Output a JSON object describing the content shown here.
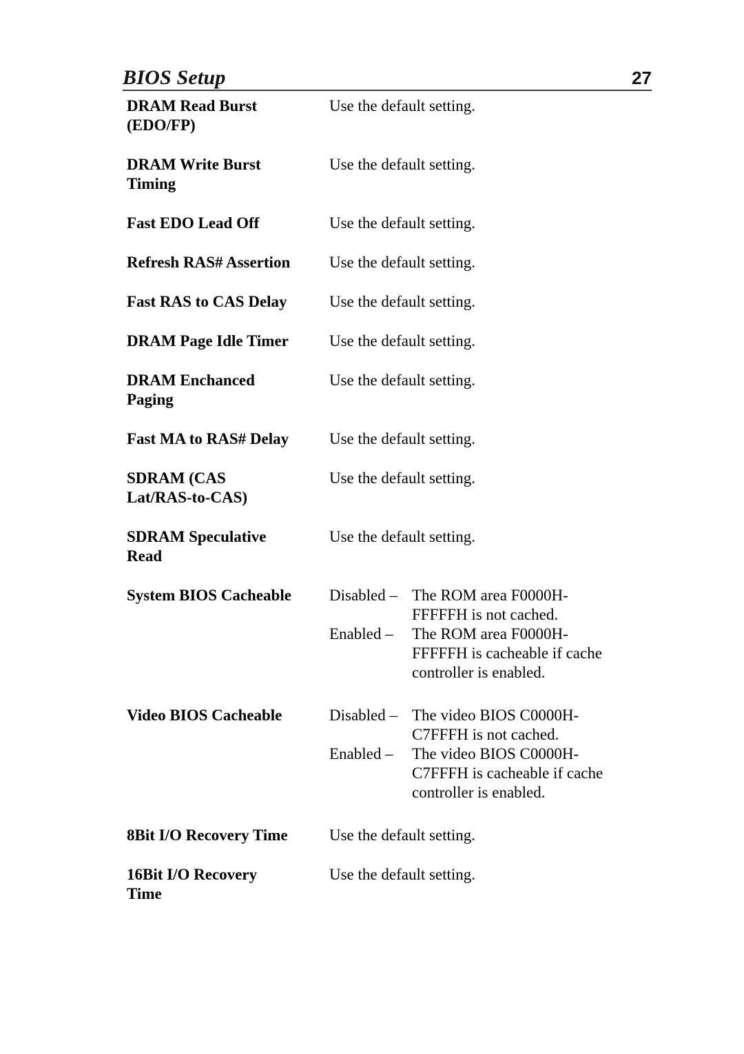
{
  "header": {
    "title": "BIOS Setup",
    "page_number": "27",
    "rule": "#3a3a3a"
  },
  "default_text": "Use the default setting.",
  "rows": [
    {
      "label_lines": [
        "DRAM Read Burst",
        "(EDO/FP)"
      ],
      "desc_lines": [
        "Use the default setting."
      ]
    },
    {
      "label_lines": [
        "DRAM Write Burst",
        "Timing"
      ],
      "desc_lines": [
        "Use the default setting."
      ]
    },
    {
      "label_lines": [
        "Fast EDO Lead Off"
      ],
      "desc_lines": [
        "Use the default setting."
      ]
    },
    {
      "label_lines": [
        "Refresh RAS# Assertion"
      ],
      "desc_lines": [
        "Use the default setting."
      ]
    },
    {
      "label_lines": [
        "Fast RAS to CAS Delay"
      ],
      "desc_lines": [
        "Use the default setting."
      ]
    },
    {
      "label_lines": [
        "DRAM Page Idle Timer"
      ],
      "desc_lines": [
        "Use the default setting."
      ]
    },
    {
      "label_lines": [
        "DRAM Enchanced",
        "Paging"
      ],
      "desc_lines": [
        "Use the default setting."
      ]
    },
    {
      "label_lines": [
        "Fast MA to RAS# Delay"
      ],
      "desc_lines": [
        "Use the default setting."
      ]
    },
    {
      "label_lines": [
        "SDRAM (CAS",
        "Lat/RAS-to-CAS)"
      ],
      "desc_lines": [
        "Use the default setting."
      ]
    },
    {
      "label_lines": [
        "SDRAM Speculative",
        "Read"
      ],
      "desc_lines": [
        "Use the default setting."
      ]
    },
    {
      "label_lines": [
        "System BIOS Cacheable"
      ],
      "options": [
        {
          "name": "Disabled –",
          "text_lines": [
            "The ROM area F0000H-",
            "FFFFFH is not cached."
          ]
        },
        {
          "name": "Enabled –",
          "text_lines": [
            "The ROM area F0000H-",
            "FFFFFH is cacheable if cache",
            "controller is enabled."
          ]
        }
      ]
    },
    {
      "label_lines": [
        "Video BIOS Cacheable"
      ],
      "options": [
        {
          "name": "Disabled –",
          "text_lines": [
            "The video BIOS C0000H-",
            "C7FFFH is not cached."
          ]
        },
        {
          "name": "Enabled –",
          "text_lines": [
            "The video BIOS C0000H-",
            "C7FFFH is cacheable if cache",
            "controller is enabled."
          ]
        }
      ]
    },
    {
      "label_lines": [
        "8Bit I/O Recovery Time"
      ],
      "desc_lines": [
        "Use the default setting."
      ]
    },
    {
      "label_lines": [
        "16Bit I/O Recovery",
        "Time"
      ],
      "desc_lines": [
        "Use the default setting."
      ]
    }
  ]
}
